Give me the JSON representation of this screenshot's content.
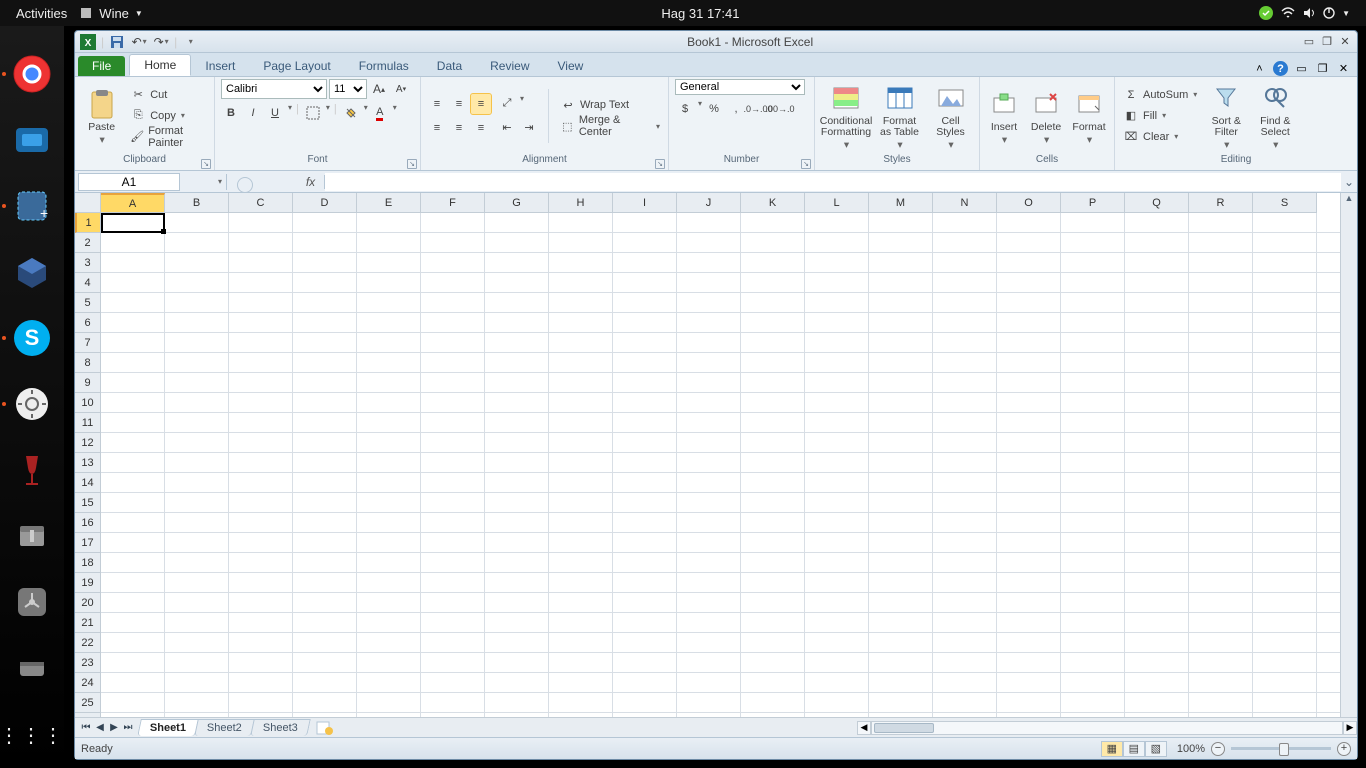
{
  "gnome": {
    "activities": "Activities",
    "app_menu": "Wine",
    "clock": "Hag 31  17:41"
  },
  "launcher": {
    "items": [
      "chrome",
      "vmware",
      "screenshot",
      "virtualbox",
      "skype",
      "settings",
      "wine",
      "archive",
      "usb",
      "disk"
    ]
  },
  "window": {
    "title": "Book1  -  Microsoft Excel"
  },
  "qat": {
    "save": "💾",
    "undo": "↶",
    "redo": "↷"
  },
  "tabs": {
    "file": "File",
    "list": [
      "Home",
      "Insert",
      "Page Layout",
      "Formulas",
      "Data",
      "Review",
      "View"
    ],
    "active": "Home"
  },
  "ribbon": {
    "clipboard": {
      "label": "Clipboard",
      "paste": "Paste",
      "cut": "Cut",
      "copy": "Copy",
      "format_painter": "Format Painter"
    },
    "font": {
      "label": "Font",
      "name": "Calibri",
      "size": "11",
      "bold": "B",
      "italic": "I",
      "underline": "U"
    },
    "alignment": {
      "label": "Alignment",
      "wrap": "Wrap Text",
      "merge": "Merge & Center"
    },
    "number": {
      "label": "Number",
      "format": "General",
      "currency": "$",
      "percent": "%",
      "comma": ","
    },
    "styles": {
      "label": "Styles",
      "conditional": "Conditional Formatting",
      "table": "Format as Table",
      "cell": "Cell Styles"
    },
    "cells": {
      "label": "Cells",
      "insert": "Insert",
      "delete": "Delete",
      "format": "Format"
    },
    "editing": {
      "label": "Editing",
      "autosum": "AutoSum",
      "fill": "Fill",
      "clear": "Clear",
      "sort": "Sort & Filter",
      "find": "Find & Select"
    }
  },
  "namebox": {
    "value": "A1"
  },
  "formula": {
    "fx": "fx",
    "value": ""
  },
  "grid": {
    "columns": [
      "A",
      "B",
      "C",
      "D",
      "E",
      "F",
      "G",
      "H",
      "I",
      "J",
      "K",
      "L",
      "M",
      "N",
      "O",
      "P",
      "Q",
      "R",
      "S"
    ],
    "rows": 26,
    "selected_cell": "A1"
  },
  "sheets": {
    "list": [
      "Sheet1",
      "Sheet2",
      "Sheet3"
    ],
    "active": "Sheet1"
  },
  "status": {
    "ready": "Ready",
    "zoom": "100%"
  }
}
